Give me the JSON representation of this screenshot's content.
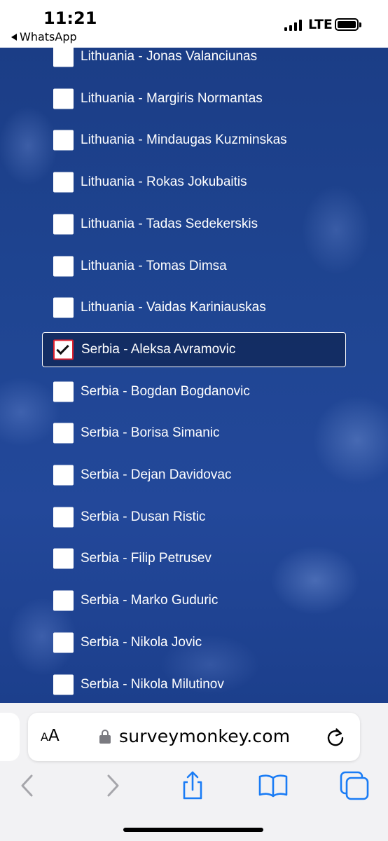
{
  "status_bar": {
    "time": "11:21",
    "back_app": "WhatsApp",
    "network": "LTE"
  },
  "survey": {
    "options": [
      {
        "label": "Lithuania - Jonas Valanciunas",
        "checked": false
      },
      {
        "label": "Lithuania - Margiris Normantas",
        "checked": false
      },
      {
        "label": "Lithuania - Mindaugas Kuzminskas",
        "checked": false
      },
      {
        "label": "Lithuania - Rokas Jokubaitis",
        "checked": false
      },
      {
        "label": "Lithuania - Tadas Sedekerskis",
        "checked": false
      },
      {
        "label": "Lithuania - Tomas Dimsa",
        "checked": false
      },
      {
        "label": "Lithuania - Vaidas Kariniauskas",
        "checked": false
      },
      {
        "label": "Serbia - Aleksa Avramovic",
        "checked": true
      },
      {
        "label": "Serbia - Bogdan Bogdanovic",
        "checked": false
      },
      {
        "label": "Serbia - Borisa Simanic",
        "checked": false
      },
      {
        "label": "Serbia - Dejan Davidovac",
        "checked": false
      },
      {
        "label": "Serbia - Dusan Ristic",
        "checked": false
      },
      {
        "label": "Serbia - Filip Petrusev",
        "checked": false
      },
      {
        "label": "Serbia - Marko Guduric",
        "checked": false
      },
      {
        "label": "Serbia - Nikola Jovic",
        "checked": false
      },
      {
        "label": "Serbia - Nikola Milutinov",
        "checked": false
      }
    ]
  },
  "browser": {
    "text_size_small": "A",
    "text_size_big": "A",
    "url": "surveymonkey.com",
    "icons": {
      "back": "chevron-left-icon",
      "forward": "chevron-right-icon",
      "share": "share-icon",
      "bookmarks": "book-icon",
      "tabs": "tabs-icon",
      "reload": "reload-icon",
      "lock": "lock-icon"
    }
  },
  "colors": {
    "background": "#1f4592",
    "checkbox_selected_border": "#e0202e",
    "toolbar_tint": "#1a7cf5",
    "toolbar_disabled": "#a6a6ab"
  }
}
